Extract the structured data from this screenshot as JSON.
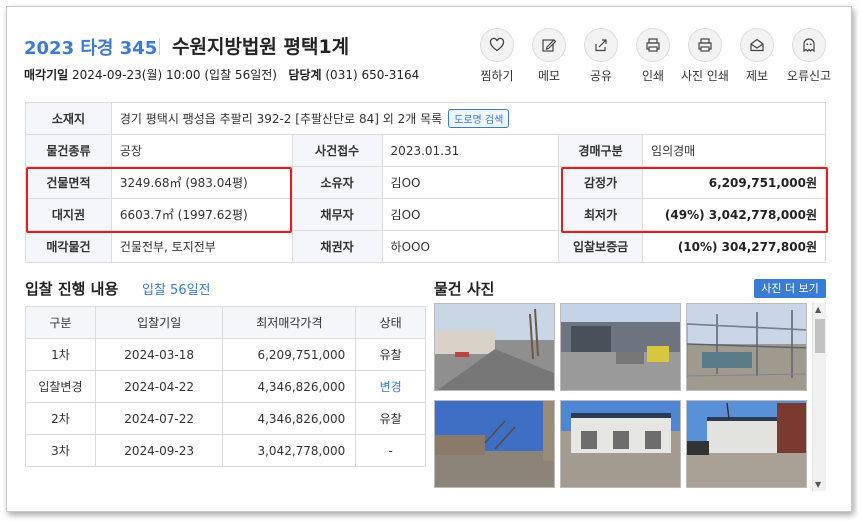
{
  "header": {
    "case_no": "2023 타경 345",
    "court": "수원지방법원 평택1계",
    "sale_date_label": "매각기일",
    "sale_date_value": "2024-09-23(월) 10:00 (입찰 56일전)",
    "dept_label": "담당계",
    "dept_phone": "(031) 650-3164"
  },
  "actions": [
    {
      "label": "찜하기",
      "icon": "heart-icon"
    },
    {
      "label": "메모",
      "icon": "pencil-icon"
    },
    {
      "label": "공유",
      "icon": "share-icon"
    },
    {
      "label": "인쇄",
      "icon": "printer-icon"
    },
    {
      "label": "사진 인쇄",
      "icon": "printer-icon"
    },
    {
      "label": "제보",
      "icon": "mail-icon"
    },
    {
      "label": "오류신고",
      "icon": "ghost-icon"
    }
  ],
  "info": {
    "address_label": "소재지",
    "address_value": "경기 평택시 팽성읍 추팔리 392-2 [추팔산단로 84] 외 2개 목록",
    "road_search_button": "도로명 검색",
    "type_label": "물건종류",
    "type_value": "공장",
    "received_label": "사건접수",
    "received_value": "2023.01.31",
    "auction_kind_label": "경매구분",
    "auction_kind_value": "임의경매",
    "building_area_label": "건물면적",
    "building_area_value": "3249.68㎡ (983.04평)",
    "owner_label": "소유자",
    "owner_value": "김OO",
    "appraisal_label": "감정가",
    "appraisal_value": "6,209,751,000원",
    "land_right_label": "대지권",
    "land_right_value": "6603.7㎡ (1997.62평)",
    "debtor_label": "채무자",
    "debtor_value": "김OO",
    "min_price_label": "최저가",
    "min_price_value": "(49%) 3,042,778,000원",
    "sale_item_label": "매각물건",
    "sale_item_value": "건물전부, 토지전부",
    "creditor_label": "채권자",
    "creditor_value": "하OOO",
    "deposit_label": "입찰보증금",
    "deposit_value": "(10%) 304,277,800원"
  },
  "bidding": {
    "title": "입찰 진행 내용",
    "subtitle": "입찰 56일전",
    "headers": [
      "구분",
      "입찰기일",
      "최저매각가격",
      "상태"
    ],
    "rows": [
      [
        "1차",
        "2024-03-18",
        "6,209,751,000",
        "유찰"
      ],
      [
        "입찰변경",
        "2024-04-22",
        "4,346,826,000",
        "변경"
      ],
      [
        "2차",
        "2024-07-22",
        "4,346,826,000",
        "유찰"
      ],
      [
        "3차",
        "2024-09-23",
        "3,042,778,000",
        "-"
      ]
    ]
  },
  "photos": {
    "title": "물건 사진",
    "more_button": "사진 더 보기"
  },
  "colors": {
    "accent": "#3a7bd5",
    "highlight_box": "#e02020",
    "header_cell": "#f4f6fa"
  }
}
